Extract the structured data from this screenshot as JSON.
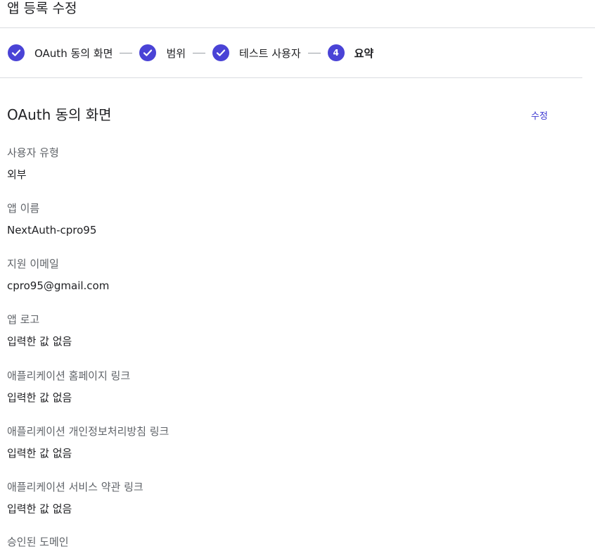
{
  "header": {
    "title": "앱 등록 수정"
  },
  "stepper": {
    "steps": [
      {
        "label": "OAuth 동의 화면",
        "state": "done"
      },
      {
        "label": "범위",
        "state": "done"
      },
      {
        "label": "테스트 사용자",
        "state": "done"
      },
      {
        "label": "요약",
        "state": "active",
        "number": "4"
      }
    ]
  },
  "section": {
    "title": "OAuth 동의 화면",
    "edit_label": "수정"
  },
  "fields": [
    {
      "label": "사용자 유형",
      "value": "외부"
    },
    {
      "label": "앱 이름",
      "value": "NextAuth-cpro95"
    },
    {
      "label": "지원 이메일",
      "value": "cpro95@gmail.com"
    },
    {
      "label": "앱 로고",
      "value": "입력한 값 없음"
    },
    {
      "label": "애플리케이션 홈페이지 링크",
      "value": "입력한 값 없음"
    },
    {
      "label": "애플리케이션 개인정보처리방침 링크",
      "value": "입력한 값 없음"
    },
    {
      "label": "애플리케이션 서비스 약관 링크",
      "value": "입력한 값 없음"
    },
    {
      "label": "승인된 도메인",
      "value": ""
    }
  ],
  "colors": {
    "accent": "#4a43d6",
    "link": "#3c37d0"
  },
  "icons": {
    "step_done": "check-circle-icon"
  }
}
